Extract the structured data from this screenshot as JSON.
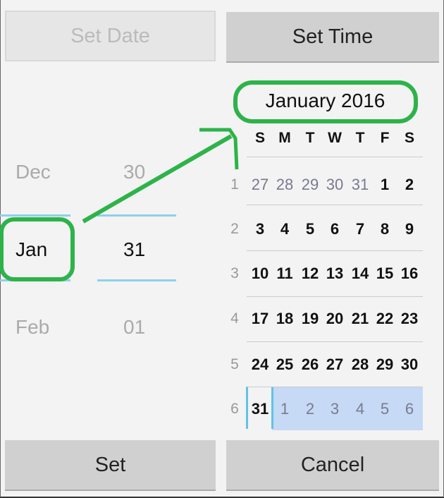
{
  "header": {
    "set_date": "Set Date",
    "set_time": "Set Time"
  },
  "spinner": {
    "months": [
      "Dec",
      "Jan",
      "Feb"
    ],
    "days": [
      "30",
      "31",
      "01"
    ]
  },
  "calendar": {
    "title": "January 2016",
    "weekdays": [
      "S",
      "M",
      "T",
      "W",
      "T",
      "F",
      "S"
    ],
    "weeks": [
      {
        "num": "1",
        "days": [
          "27",
          "28",
          "29",
          "30",
          "31",
          "1",
          "2"
        ]
      },
      {
        "num": "2",
        "days": [
          "3",
          "4",
          "5",
          "6",
          "7",
          "8",
          "9"
        ]
      },
      {
        "num": "3",
        "days": [
          "10",
          "11",
          "12",
          "13",
          "14",
          "15",
          "16"
        ]
      },
      {
        "num": "4",
        "days": [
          "17",
          "18",
          "19",
          "20",
          "21",
          "22",
          "23"
        ]
      },
      {
        "num": "5",
        "days": [
          "24",
          "25",
          "26",
          "27",
          "28",
          "29",
          "30"
        ]
      },
      {
        "num": "6",
        "days": [
          "31",
          "1",
          "2",
          "3",
          "4",
          "5",
          "6"
        ]
      }
    ],
    "selected": "31"
  },
  "footer": {
    "set": "Set",
    "cancel": "Cancel"
  },
  "colors": {
    "annotation": "#2db34a",
    "accent": "#5ec4e6",
    "selection": "#c6d9f5"
  }
}
